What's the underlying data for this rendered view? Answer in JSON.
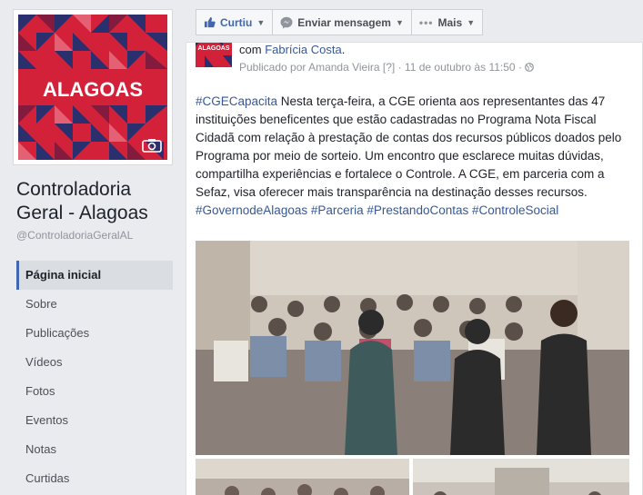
{
  "page": {
    "logo_text": "ALAGOAS",
    "name": "Controladoria Geral - Alagoas",
    "handle": "@ControladoriaGeralAL"
  },
  "nav": {
    "items": [
      {
        "label": "Página inicial",
        "active": true
      },
      {
        "label": "Sobre"
      },
      {
        "label": "Publicações"
      },
      {
        "label": "Vídeos"
      },
      {
        "label": "Fotos"
      },
      {
        "label": "Eventos"
      },
      {
        "label": "Notas"
      },
      {
        "label": "Curtidas"
      }
    ]
  },
  "actions": {
    "like": "Curtiu",
    "message": "Enviar mensagem",
    "more": "Mais"
  },
  "post": {
    "with_prefix": "com",
    "with_name": "Fabrícia Costa",
    "with_suffix": ".",
    "published_by_prefix": "Publicado por",
    "published_by": "Amanda Vieira",
    "help": "[?]",
    "date": "· 11 de outubro às 11:50 ·",
    "text_tag1": "#CGECapacita",
    "text_body": " Nesta terça-feira, a CGE orienta aos representantes das 47 instituições beneficentes que estão cadastradas no Programa Nota Fiscal Cidadã com relação à prestação de contas dos recursos públicos doados pelo Programa por meio de sorteio. Um encontro que esclarece muitas dúvidas, compartilha experiências e fortalece o Controle. A CGE, em parceria com a Sefaz, visa oferecer mais transparência na destinação desses recursos. ",
    "hashtags": [
      "#GovernodeAlagoas",
      "#Parceria",
      "#PrestandoContas",
      "#ControleSocial"
    ]
  },
  "colors": {
    "brand_blue": "#4267b2",
    "link": "#365899",
    "logo_red": "#d3213a",
    "logo_navy": "#2a2f6e"
  }
}
